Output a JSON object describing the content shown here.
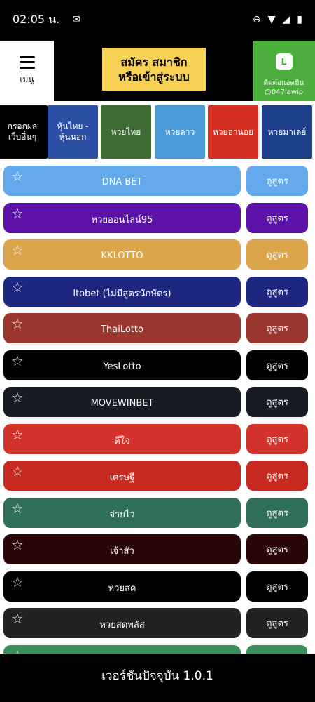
{
  "status": {
    "time": "02:05 น.",
    "msg_icon": "message-icon"
  },
  "header": {
    "menu_label": "เมนู",
    "signup_line1": "สมัคร สมาชิก",
    "signup_line2": "หรือเข้าสู่ระบบ",
    "line_icon": "L",
    "line_text1": "ติดต่อแอดมิน",
    "line_text2": "@047iawip"
  },
  "categories": [
    {
      "line1": "กรอกผล",
      "line2": "เว็บอื่นๆ",
      "color": "#000000"
    },
    {
      "line1": "หุ้นไทย -",
      "line2": "หุ้นนอก",
      "color": "#2b4fa3"
    },
    {
      "line1": "หวยไทย",
      "line2": "",
      "color": "#3f6b34"
    },
    {
      "line1": "หวยลาว",
      "line2": "",
      "color": "#4b9bd8"
    },
    {
      "line1": "หวยฮานอย",
      "line2": "",
      "color": "#d62f23"
    },
    {
      "line1": "หวยมาเลย์",
      "line2": "",
      "color": "#1d3f8a"
    }
  ],
  "rows": [
    {
      "name": "DNA BET",
      "button": "ดูสูตร",
      "color": "#63a9ec"
    },
    {
      "name": "หวยออนไลน์95",
      "button": "ดูสูตร",
      "color": "#5c11a8"
    },
    {
      "name": "KKLOTTO",
      "button": "ดูสูตร",
      "color": "#dca549"
    },
    {
      "name": "ltobet (ไม่มีสูตรนักษัตร)",
      "button": "ดูสูตร",
      "color": "#1d2780"
    },
    {
      "name": "ThaiLotto",
      "button": "ดูสูตร",
      "color": "#9b362e"
    },
    {
      "name": "YesLotto",
      "button": "ดูสูตร",
      "color": "#000000"
    },
    {
      "name": "MOVEWINBET",
      "button": "ดูสูตร",
      "color": "#161b24"
    },
    {
      "name": "ดีใจ",
      "button": "ดูสูตร",
      "color": "#d2312c"
    },
    {
      "name": "เศรษฐี",
      "button": "ดูสูตร",
      "color": "#c72a20"
    },
    {
      "name": "จ่ายไว",
      "button": "ดูสูตร",
      "color": "#2f6e59"
    },
    {
      "name": "เจ้าสัว",
      "button": "ดูสูตร",
      "color": "#2b0606"
    },
    {
      "name": "หวยสด",
      "button": "ดูสูตร",
      "color": "#000000"
    },
    {
      "name": "หวยสดพลัส",
      "button": "ดูสูตร",
      "color": "#222222"
    },
    {
      "name": "",
      "button": "",
      "color": "#3c8e5f"
    }
  ],
  "footer": {
    "version": "เวอร์ชันปัจจุบัน 1.0.1"
  }
}
